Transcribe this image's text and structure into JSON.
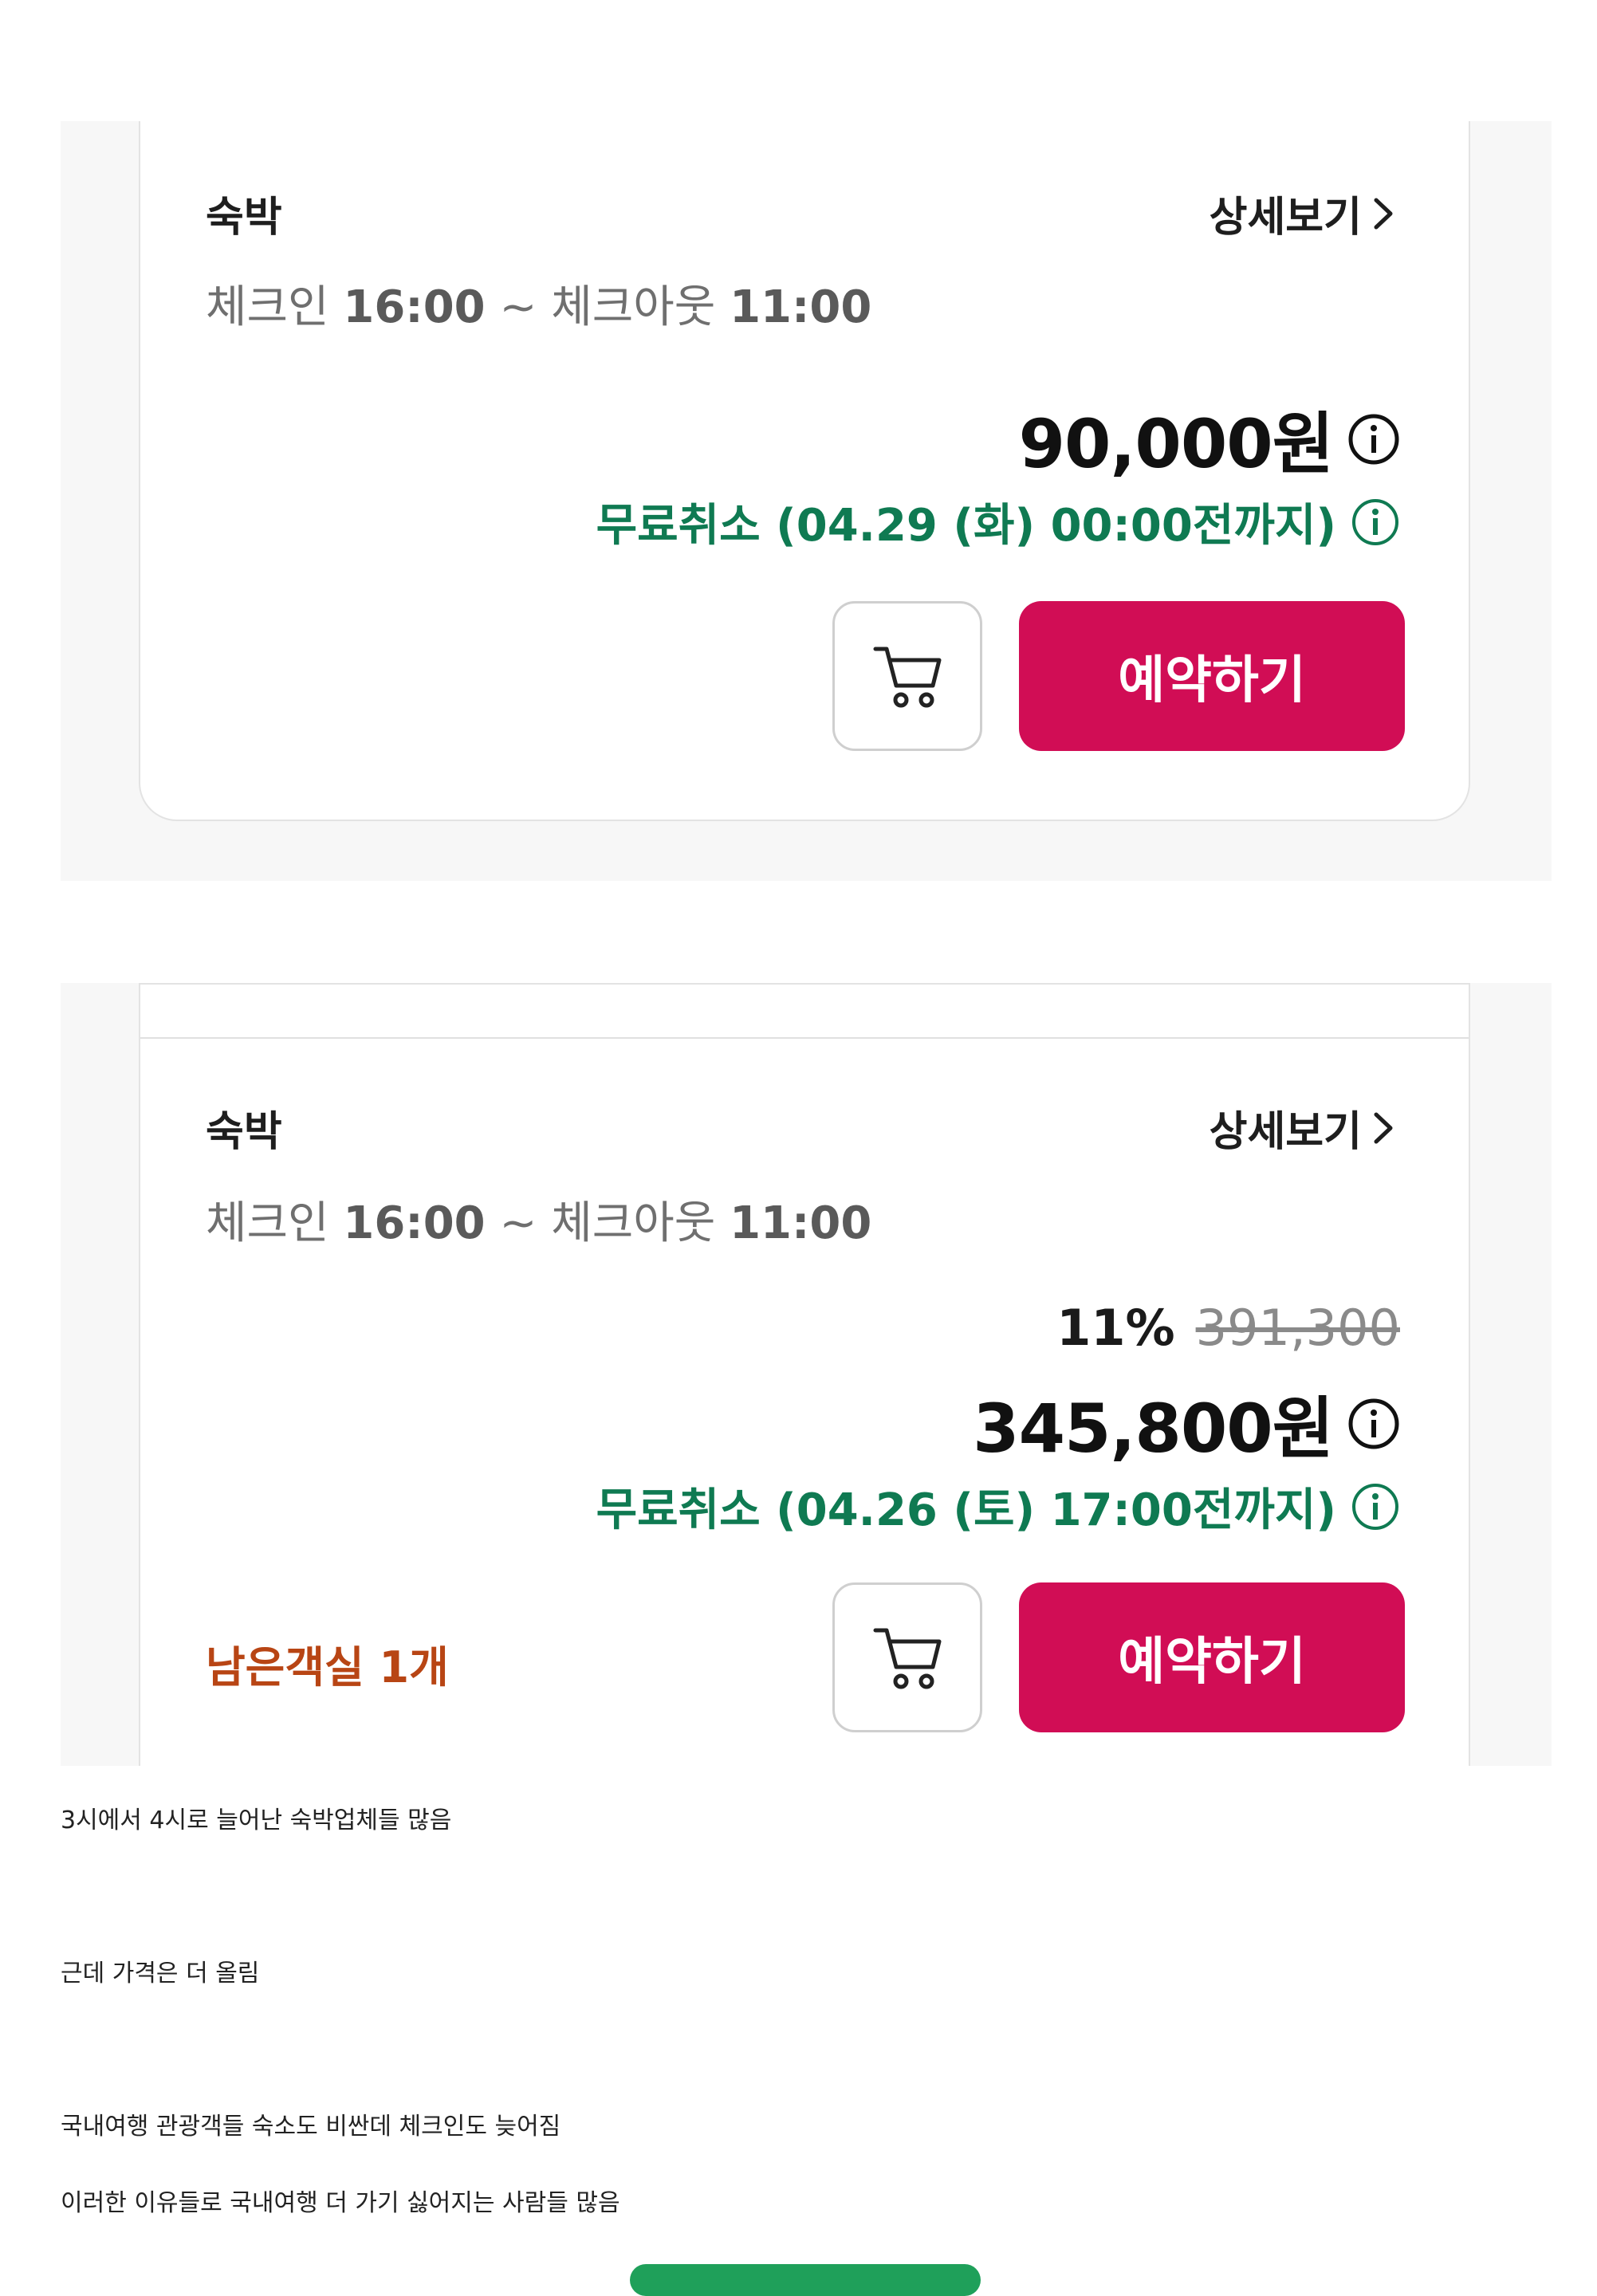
{
  "listings": [
    {
      "type_label": "숙박",
      "detail_label": "상세보기",
      "checkin_label": "체크인",
      "checkin_time": "16:00",
      "separator": "~",
      "checkout_label": "체크아웃",
      "checkout_time": "11:00",
      "price": "90,000원",
      "free_cancel": "무료취소 (04.29 (화) 00:00전까지)",
      "reserve_label": "예약하기"
    },
    {
      "type_label": "숙박",
      "detail_label": "상세보기",
      "checkin_label": "체크인",
      "checkin_time": "16:00",
      "separator": "~",
      "checkout_label": "체크아웃",
      "checkout_time": "11:00",
      "discount_percent": "11%",
      "original_price": "391,300",
      "price": "345,800원",
      "free_cancel": "무료취소 (04.26 (토) 17:00전까지)",
      "rooms_left": "남은객실 1개",
      "reserve_label": "예약하기"
    }
  ],
  "post_text": [
    "3시에서 4시로 늘어난 숙박업체들 많음",
    "근데 가격은 더 올림",
    "국내여행 관광객들 숙소도 비싼데 체크인도 늦어짐",
    "이러한 이유들로 국내여행 더 가기 싫어지는 사람들 많음"
  ],
  "colors": {
    "accent_pink": "#d10d55",
    "cancel_green": "#0f7a52",
    "rooms_left_orange": "#b84514",
    "bottom_button_green": "#1fa05a"
  },
  "icons": {
    "chevron": "chevron-right-icon",
    "info": "info-circle-icon",
    "cart": "shopping-cart-icon"
  }
}
